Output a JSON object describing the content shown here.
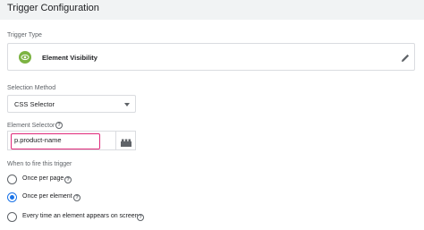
{
  "header": {
    "title": "Trigger Configuration"
  },
  "trigger_type": {
    "label": "Trigger Type",
    "name": "Element Visibility",
    "icon": "eye-icon",
    "icon_color": "#7cb342",
    "edit_icon": "pencil-icon"
  },
  "selection_method": {
    "label": "Selection Method",
    "value": "CSS Selector"
  },
  "element_selector": {
    "label": "Element Selector",
    "value": "p.product-name",
    "help_icon": "?",
    "picker_icon": "building-block-icon",
    "highlight_color": "#e0297a"
  },
  "fire": {
    "label": "When to fire this trigger",
    "options": [
      {
        "label": "Once per page",
        "checked": false
      },
      {
        "label": "Once per element",
        "checked": true
      },
      {
        "label": "Every time an element appears on screen",
        "checked": false
      }
    ],
    "help_icon": "?"
  }
}
